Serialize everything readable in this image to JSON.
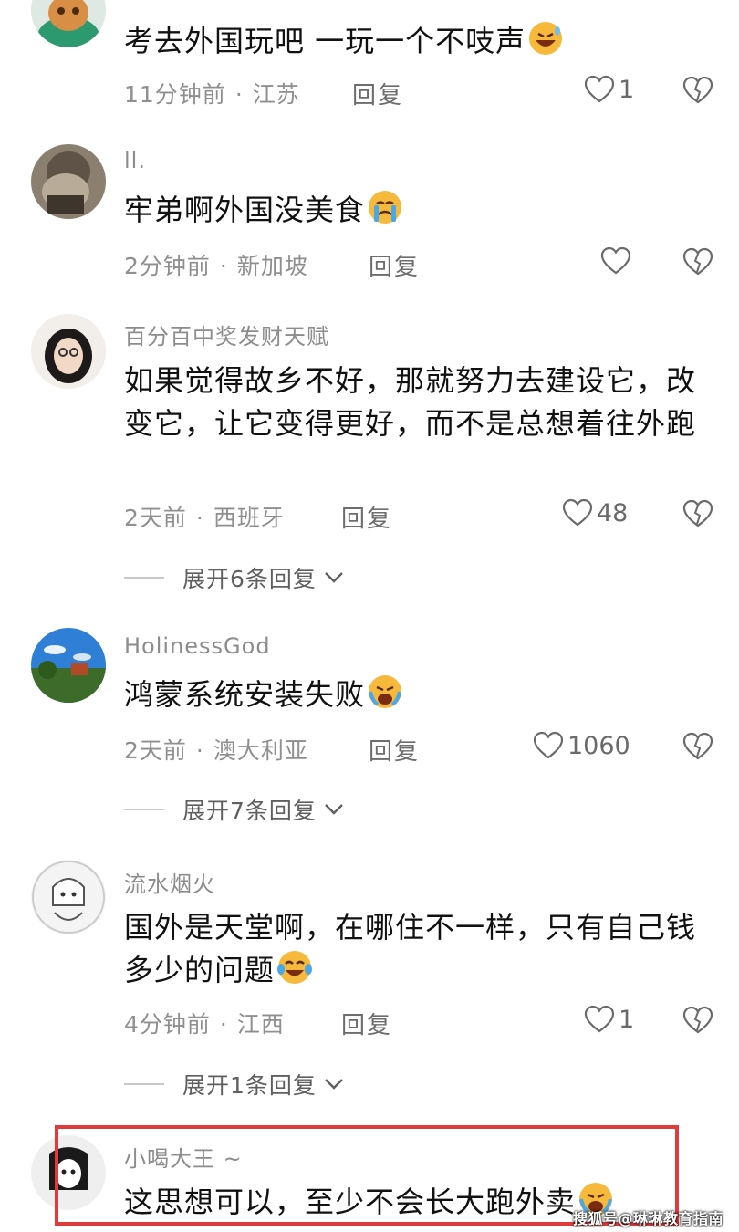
{
  "comments": [
    {
      "username": "",
      "text": "考去外国玩吧 一玩一个不吱声",
      "time": "11分钟前",
      "location": "江苏",
      "reply_label": "回复",
      "likes": "1",
      "emoji": "grinning-sweat-emoji"
    },
    {
      "username": "ll.",
      "text": "牢弟啊外国没美食",
      "time": "2分钟前",
      "location": "新加坡",
      "reply_label": "回复",
      "likes": "",
      "emoji": "crying-emoji"
    },
    {
      "username": "百分百中奖发财天赋",
      "text": "如果觉得故乡不好，那就努力去建设它，改变它，让它变得更好，而不是总想着往外跑",
      "time": "2天前",
      "location": "西班牙",
      "reply_label": "回复",
      "likes": "48",
      "expand_label": "展开6条回复"
    },
    {
      "username": "HolinessGod",
      "text": "鸿蒙系统安装失败",
      "time": "2天前",
      "location": "澳大利亚",
      "reply_label": "回复",
      "likes": "1060",
      "emoji": "loudly-crying-emoji",
      "expand_label": "展开7条回复"
    },
    {
      "username": "流水烟火",
      "text": "国外是天堂啊，在哪住不一样，只有自己钱多少的问题",
      "time": "4分钟前",
      "location": "江西",
      "reply_label": "回复",
      "likes": "1",
      "emoji": "tears-of-joy-emoji",
      "expand_label": "展开1条回复"
    },
    {
      "username": "小喝大王 ~",
      "text": "这思想可以，至少不会长大跑外卖",
      "emoji": "loudly-crying-emoji"
    }
  ],
  "watermark": "搜狐号@琳琳教育指南",
  "colors": {
    "highlight_border": "#e03b3b",
    "meta_text": "#8f8f8f"
  }
}
